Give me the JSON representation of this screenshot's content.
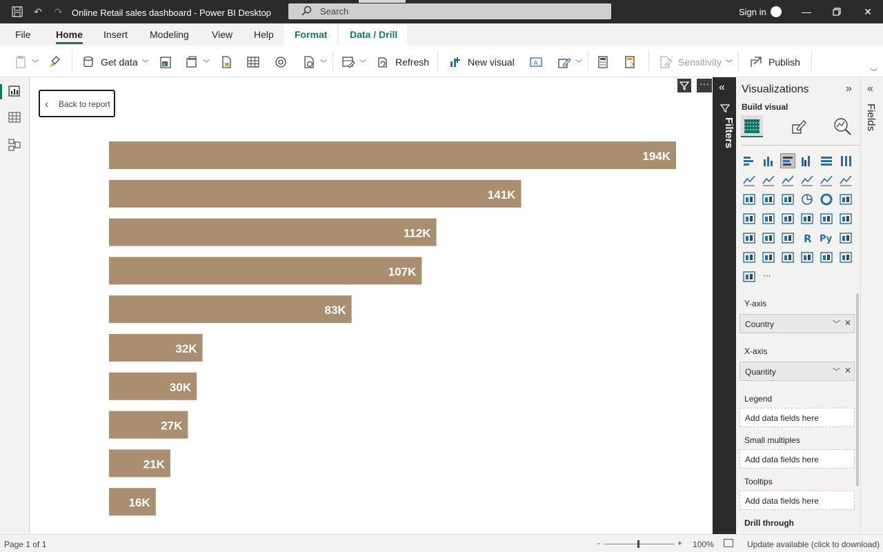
{
  "app": {
    "title": "Online Retail sales dashboard - Power BI Desktop",
    "search_placeholder": "Search",
    "sign_in": "Sign in"
  },
  "tabs": [
    "File",
    "Home",
    "Insert",
    "Modeling",
    "View",
    "Help",
    "Format",
    "Data / Drill"
  ],
  "active_tab": "Home",
  "ribbon": {
    "get_data": "Get data",
    "refresh": "Refresh",
    "new_visual": "New visual",
    "sensitivity": "Sensitivity",
    "publish": "Publish"
  },
  "canvas": {
    "back_button": "Back to report"
  },
  "chart_data": {
    "type": "bar",
    "orientation": "horizontal",
    "values": [
      194,
      141,
      112,
      107,
      83,
      32,
      30,
      27,
      21,
      16
    ],
    "labels": [
      "194K",
      "141K",
      "112K",
      "107K",
      "83K",
      "32K",
      "30K",
      "27K",
      "21K",
      "16K"
    ],
    "value_unit": "K",
    "xlim": [
      0,
      194
    ],
    "bar_color": "#a98f70",
    "data_label_color": "#ffffff",
    "axes_visible": false
  },
  "filters_pane": {
    "label": "Filters"
  },
  "visualizations": {
    "title": "Visualizations",
    "build_visual": "Build visual",
    "wells": [
      {
        "label": "Y-axis",
        "value": "Country",
        "filled": true
      },
      {
        "label": "X-axis",
        "value": "Quantity",
        "filled": true
      },
      {
        "label": "Legend",
        "value": "Add data fields here",
        "filled": false
      },
      {
        "label": "Small multiples",
        "value": "Add data fields here",
        "filled": false
      },
      {
        "label": "Tooltips",
        "value": "Add data fields here",
        "filled": false
      }
    ],
    "drill_through": "Drill through"
  },
  "fields_pane": {
    "label": "Fields"
  },
  "status": {
    "page": "Page 1 of 1",
    "zoom": "100%",
    "update": "Update available (click to download)",
    "zoom_minus": "-",
    "zoom_plus": "+"
  },
  "colors": {
    "accent": "#117865",
    "dark": "#2b2b2b",
    "visual_icon": "#1f6fb2"
  }
}
